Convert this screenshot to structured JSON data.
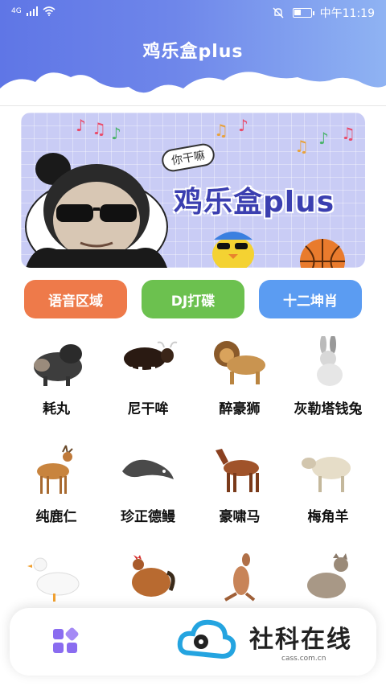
{
  "status_bar": {
    "network": "4G",
    "time": "中午11:19"
  },
  "app": {
    "title": "鸡乐盒plus"
  },
  "banner": {
    "bubble_text": "你干嘛",
    "title": "鸡乐盒plus"
  },
  "categories": [
    {
      "label": "语音区域",
      "color": "#ee7a4a"
    },
    {
      "label": "DJ打碟",
      "color": "#6cc14f"
    },
    {
      "label": "十二坤肖",
      "color": "#5b9cf2"
    }
  ],
  "animals": [
    {
      "name": "耗丸",
      "icon": "boar-image"
    },
    {
      "name": "尼干哞",
      "icon": "ox-image"
    },
    {
      "name": "醉豪狮",
      "icon": "lion-image"
    },
    {
      "name": "灰勒塔钱兔",
      "icon": "rabbit-image"
    },
    {
      "name": "纯鹿仁",
      "icon": "deer-image"
    },
    {
      "name": "珍正德鳗",
      "icon": "eel-image"
    },
    {
      "name": "豪啸马",
      "icon": "horse-image"
    },
    {
      "name": "梅角羊",
      "icon": "sheep-image"
    },
    {
      "name": "",
      "icon": "duck-image"
    },
    {
      "name": "",
      "icon": "rooster-image"
    },
    {
      "name": "",
      "icon": "kangaroo-image"
    },
    {
      "name": "",
      "icon": "cat-image"
    }
  ],
  "bottom_nav": {
    "home_icon": "apps-grid-icon"
  },
  "watermark": {
    "text": "社科在线",
    "sub": "cass.com.cn"
  }
}
